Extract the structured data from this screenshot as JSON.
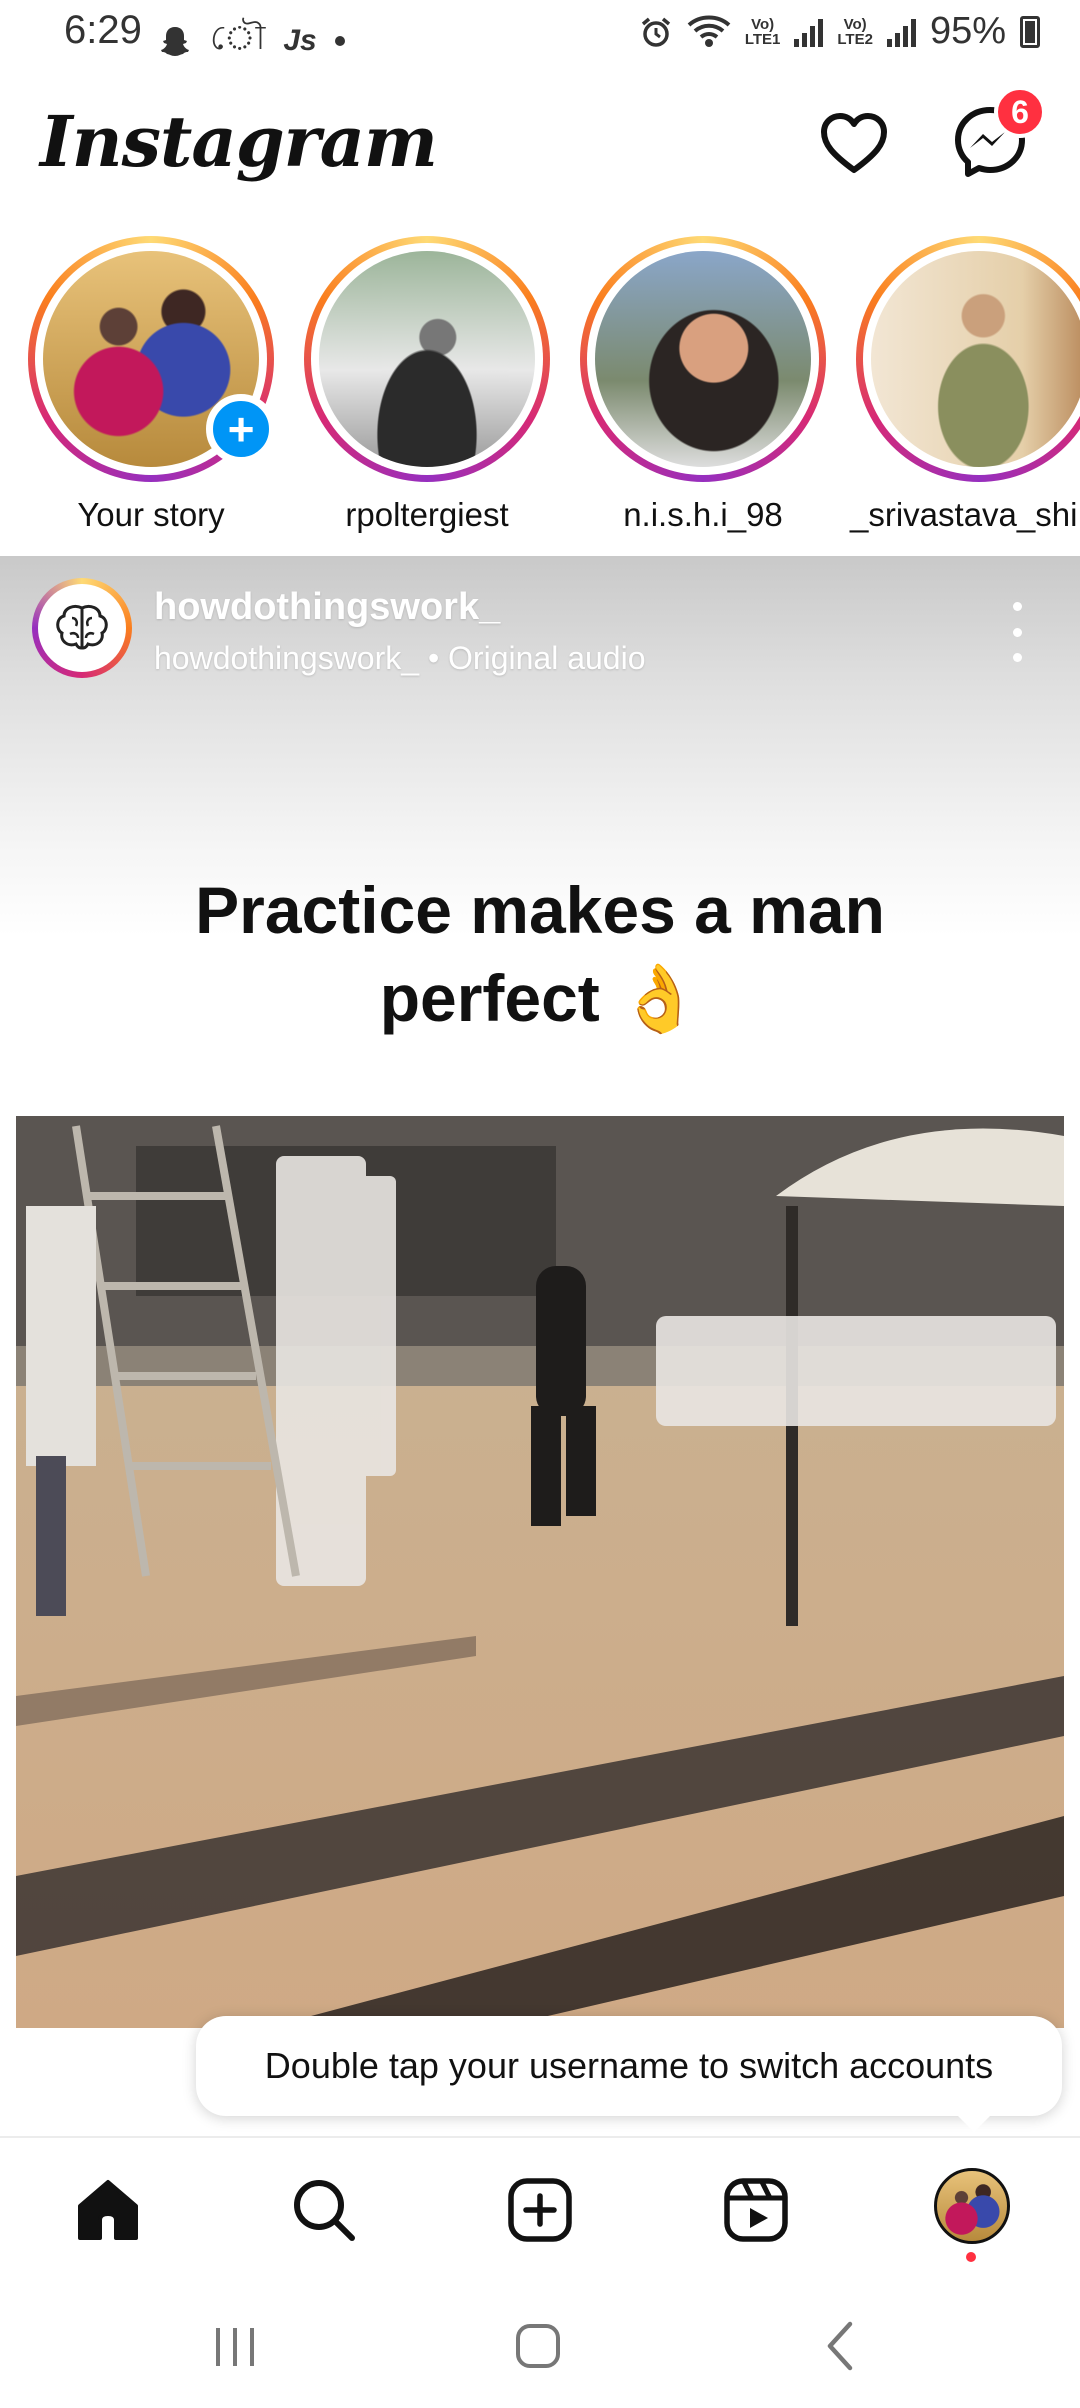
{
  "status_bar": {
    "time": "6:29",
    "net1": "Vo)\nLTE1",
    "net2": "Vo)\nLTE2",
    "battery": "95%",
    "icons": [
      "snapchat-icon",
      "app-icon",
      "js-icon",
      "dot-icon",
      "alarm-icon",
      "wifi-icon",
      "signal-icon",
      "battery-icon"
    ]
  },
  "header": {
    "logo": "Instagram",
    "notifications_icon": "heart-icon",
    "messenger_icon": "messenger-icon",
    "messenger_badge": "6"
  },
  "stories": [
    {
      "name": "Your story",
      "own": true
    },
    {
      "name": "rpoltergiest"
    },
    {
      "name": "n.i.s.h.i_98"
    },
    {
      "name": "_srivastava_shi"
    }
  ],
  "post": {
    "username": "howdothingswork_",
    "subtitle": "howdothingswork_ • Original audio",
    "caption_line1": "Practice makes a man",
    "caption_line2": "perfect 👌"
  },
  "tooltip": {
    "text": "Double tap your username to switch accounts"
  },
  "bottom_nav": [
    "home-icon",
    "search-icon",
    "create-icon",
    "reels-icon",
    "profile-avatar"
  ],
  "colors": {
    "badge": "#ff3040",
    "accent": "#0095f6",
    "text": "#111111"
  }
}
